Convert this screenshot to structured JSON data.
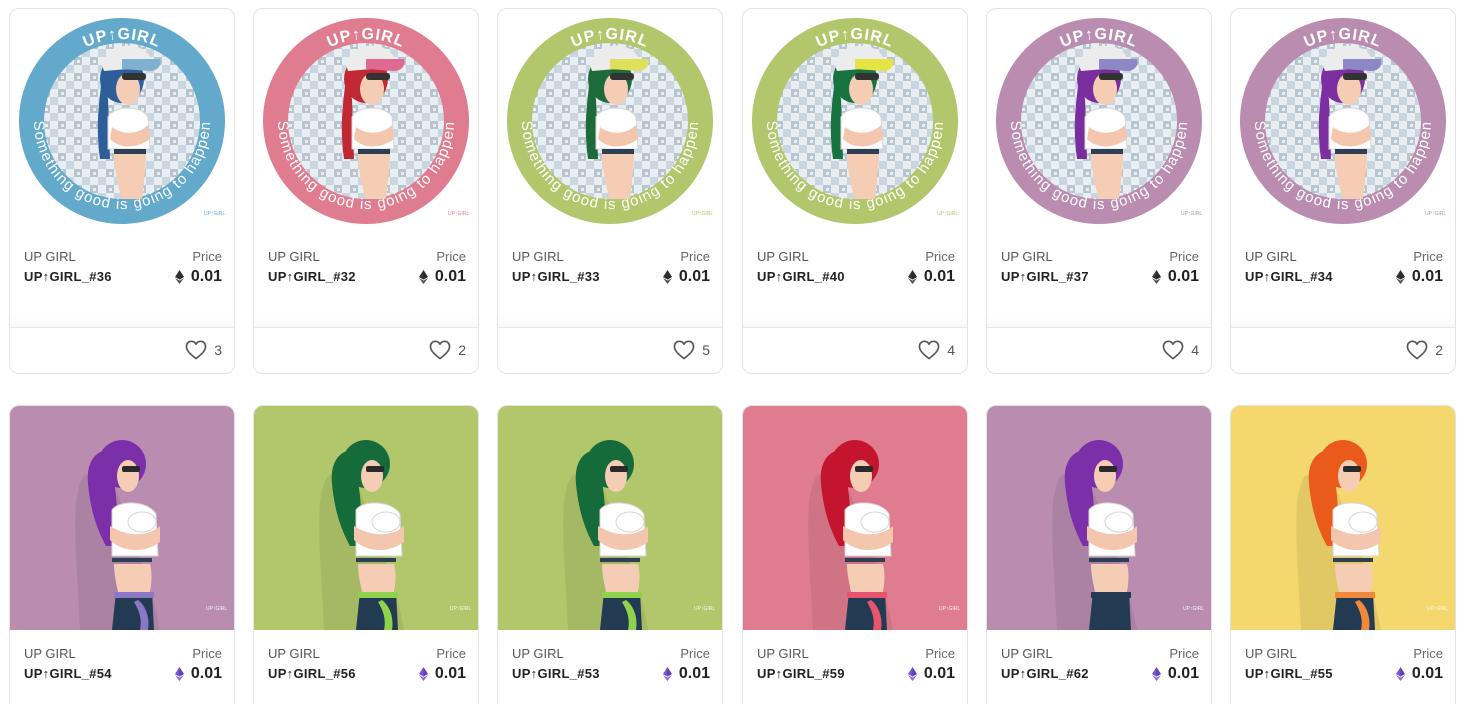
{
  "labels": {
    "collection": "UP GIRL",
    "price": "Price"
  },
  "colors": {
    "blue": "#63a9cb",
    "pink": "#e07c8f",
    "green": "#b2c66c",
    "mauve": "#b98cb0",
    "yellow": "#f4d86d",
    "eth_dark": "#333333",
    "eth_purple": "#7b4fd6"
  },
  "row1": [
    {
      "name": "UP↑GIRL_#36",
      "price": "0.01",
      "likes": "3",
      "ring": "blue",
      "hair": "#2d5e9a",
      "visor": "#7fb0cf"
    },
    {
      "name": "UP↑GIRL_#32",
      "price": "0.01",
      "likes": "2",
      "ring": "pink",
      "hair": "#c02834",
      "visor": "#e06a8f"
    },
    {
      "name": "UP↑GIRL_#33",
      "price": "0.01",
      "likes": "5",
      "ring": "green",
      "hair": "#1f6a3a",
      "visor": "#dfe05a"
    },
    {
      "name": "UP↑GIRL_#40",
      "price": "0.01",
      "likes": "4",
      "ring": "green",
      "hair": "#17733f",
      "visor": "#e6e344"
    },
    {
      "name": "UP↑GIRL_#37",
      "price": "0.01",
      "likes": "4",
      "ring": "mauve",
      "hair": "#7a2e9e",
      "visor": "#8d86c7"
    },
    {
      "name": "UP↑GIRL_#34",
      "price": "0.01",
      "likes": "2",
      "ring": "mauve",
      "hair": "#7b2fa0",
      "visor": "#8d86c7"
    }
  ],
  "row2": [
    {
      "name": "UP↑GIRL_#54",
      "price": "0.01",
      "bg": "mauve",
      "hair": "#7b2fa8",
      "belt": "#8c77c7"
    },
    {
      "name": "UP↑GIRL_#56",
      "price": "0.01",
      "bg": "green",
      "hair": "#156b3a",
      "belt": "#8ed24e"
    },
    {
      "name": "UP↑GIRL_#53",
      "price": "0.01",
      "bg": "green",
      "hair": "#156b3a",
      "belt": "#8ed24e"
    },
    {
      "name": "UP↑GIRL_#59",
      "price": "0.01",
      "bg": "pink",
      "hair": "#c3162e",
      "belt": "#e7546e"
    },
    {
      "name": "UP↑GIRL_#62",
      "price": "0.01",
      "bg": "mauve",
      "hair": "#7b2fa8",
      "belt": "#233b52"
    },
    {
      "name": "UP↑GIRL_#55",
      "price": "0.01",
      "bg": "yellow",
      "hair": "#ea5a1b",
      "belt": "#f08a3a"
    }
  ],
  "image_text": {
    "ring_top": "UP↑GIRL",
    "ring_phrase": "Something good is going to happen",
    "signature": "UP↑GIRL"
  }
}
